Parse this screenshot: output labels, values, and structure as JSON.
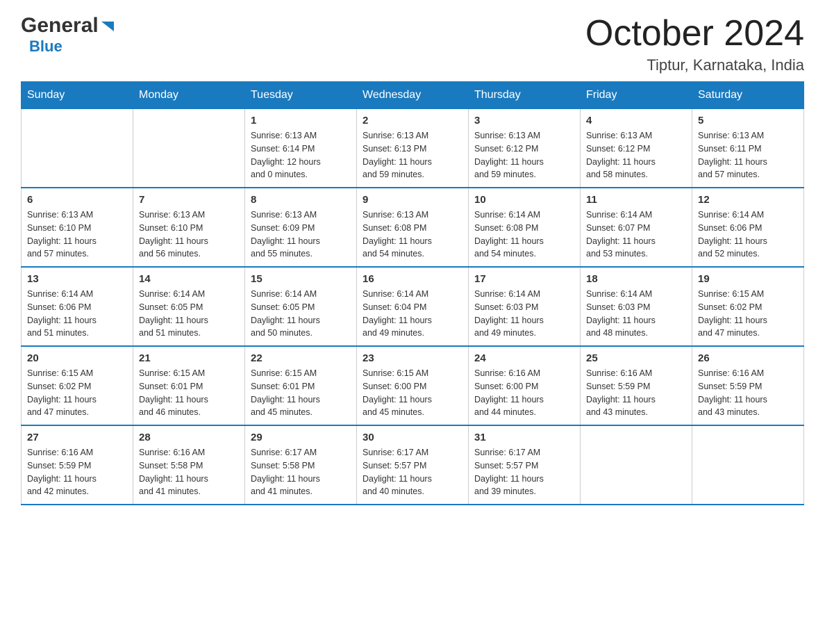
{
  "header": {
    "logo_general": "General",
    "logo_blue": "Blue",
    "title": "October 2024",
    "subtitle": "Tiptur, Karnataka, India"
  },
  "calendar": {
    "weekdays": [
      "Sunday",
      "Monday",
      "Tuesday",
      "Wednesday",
      "Thursday",
      "Friday",
      "Saturday"
    ],
    "weeks": [
      [
        {
          "day": "",
          "info": ""
        },
        {
          "day": "",
          "info": ""
        },
        {
          "day": "1",
          "info": "Sunrise: 6:13 AM\nSunset: 6:14 PM\nDaylight: 12 hours\nand 0 minutes."
        },
        {
          "day": "2",
          "info": "Sunrise: 6:13 AM\nSunset: 6:13 PM\nDaylight: 11 hours\nand 59 minutes."
        },
        {
          "day": "3",
          "info": "Sunrise: 6:13 AM\nSunset: 6:12 PM\nDaylight: 11 hours\nand 59 minutes."
        },
        {
          "day": "4",
          "info": "Sunrise: 6:13 AM\nSunset: 6:12 PM\nDaylight: 11 hours\nand 58 minutes."
        },
        {
          "day": "5",
          "info": "Sunrise: 6:13 AM\nSunset: 6:11 PM\nDaylight: 11 hours\nand 57 minutes."
        }
      ],
      [
        {
          "day": "6",
          "info": "Sunrise: 6:13 AM\nSunset: 6:10 PM\nDaylight: 11 hours\nand 57 minutes."
        },
        {
          "day": "7",
          "info": "Sunrise: 6:13 AM\nSunset: 6:10 PM\nDaylight: 11 hours\nand 56 minutes."
        },
        {
          "day": "8",
          "info": "Sunrise: 6:13 AM\nSunset: 6:09 PM\nDaylight: 11 hours\nand 55 minutes."
        },
        {
          "day": "9",
          "info": "Sunrise: 6:13 AM\nSunset: 6:08 PM\nDaylight: 11 hours\nand 54 minutes."
        },
        {
          "day": "10",
          "info": "Sunrise: 6:14 AM\nSunset: 6:08 PM\nDaylight: 11 hours\nand 54 minutes."
        },
        {
          "day": "11",
          "info": "Sunrise: 6:14 AM\nSunset: 6:07 PM\nDaylight: 11 hours\nand 53 minutes."
        },
        {
          "day": "12",
          "info": "Sunrise: 6:14 AM\nSunset: 6:06 PM\nDaylight: 11 hours\nand 52 minutes."
        }
      ],
      [
        {
          "day": "13",
          "info": "Sunrise: 6:14 AM\nSunset: 6:06 PM\nDaylight: 11 hours\nand 51 minutes."
        },
        {
          "day": "14",
          "info": "Sunrise: 6:14 AM\nSunset: 6:05 PM\nDaylight: 11 hours\nand 51 minutes."
        },
        {
          "day": "15",
          "info": "Sunrise: 6:14 AM\nSunset: 6:05 PM\nDaylight: 11 hours\nand 50 minutes."
        },
        {
          "day": "16",
          "info": "Sunrise: 6:14 AM\nSunset: 6:04 PM\nDaylight: 11 hours\nand 49 minutes."
        },
        {
          "day": "17",
          "info": "Sunrise: 6:14 AM\nSunset: 6:03 PM\nDaylight: 11 hours\nand 49 minutes."
        },
        {
          "day": "18",
          "info": "Sunrise: 6:14 AM\nSunset: 6:03 PM\nDaylight: 11 hours\nand 48 minutes."
        },
        {
          "day": "19",
          "info": "Sunrise: 6:15 AM\nSunset: 6:02 PM\nDaylight: 11 hours\nand 47 minutes."
        }
      ],
      [
        {
          "day": "20",
          "info": "Sunrise: 6:15 AM\nSunset: 6:02 PM\nDaylight: 11 hours\nand 47 minutes."
        },
        {
          "day": "21",
          "info": "Sunrise: 6:15 AM\nSunset: 6:01 PM\nDaylight: 11 hours\nand 46 minutes."
        },
        {
          "day": "22",
          "info": "Sunrise: 6:15 AM\nSunset: 6:01 PM\nDaylight: 11 hours\nand 45 minutes."
        },
        {
          "day": "23",
          "info": "Sunrise: 6:15 AM\nSunset: 6:00 PM\nDaylight: 11 hours\nand 45 minutes."
        },
        {
          "day": "24",
          "info": "Sunrise: 6:16 AM\nSunset: 6:00 PM\nDaylight: 11 hours\nand 44 minutes."
        },
        {
          "day": "25",
          "info": "Sunrise: 6:16 AM\nSunset: 5:59 PM\nDaylight: 11 hours\nand 43 minutes."
        },
        {
          "day": "26",
          "info": "Sunrise: 6:16 AM\nSunset: 5:59 PM\nDaylight: 11 hours\nand 43 minutes."
        }
      ],
      [
        {
          "day": "27",
          "info": "Sunrise: 6:16 AM\nSunset: 5:59 PM\nDaylight: 11 hours\nand 42 minutes."
        },
        {
          "day": "28",
          "info": "Sunrise: 6:16 AM\nSunset: 5:58 PM\nDaylight: 11 hours\nand 41 minutes."
        },
        {
          "day": "29",
          "info": "Sunrise: 6:17 AM\nSunset: 5:58 PM\nDaylight: 11 hours\nand 41 minutes."
        },
        {
          "day": "30",
          "info": "Sunrise: 6:17 AM\nSunset: 5:57 PM\nDaylight: 11 hours\nand 40 minutes."
        },
        {
          "day": "31",
          "info": "Sunrise: 6:17 AM\nSunset: 5:57 PM\nDaylight: 11 hours\nand 39 minutes."
        },
        {
          "day": "",
          "info": ""
        },
        {
          "day": "",
          "info": ""
        }
      ]
    ]
  }
}
